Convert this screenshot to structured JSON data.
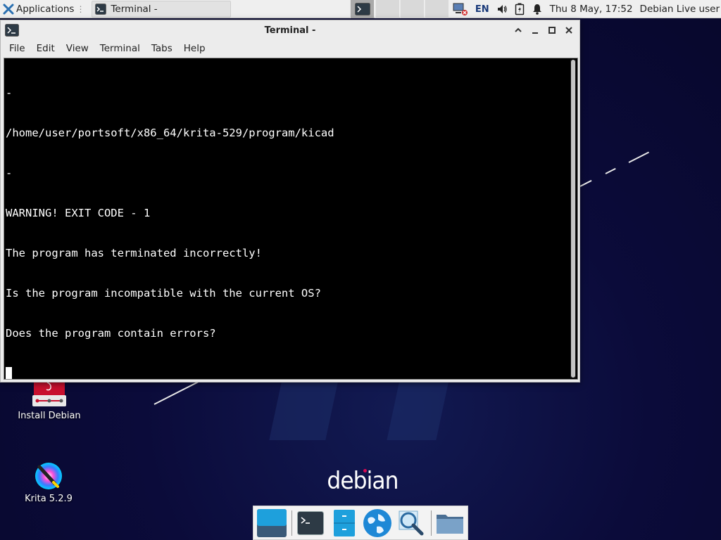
{
  "top_panel": {
    "applications_label": "Applications",
    "task_label": "Terminal -",
    "language": "EN",
    "clock": "Thu  8 May, 17:52",
    "user": "Debian Live user"
  },
  "window": {
    "title": "Terminal -",
    "menu": [
      "File",
      "Edit",
      "View",
      "Terminal",
      "Tabs",
      "Help"
    ],
    "terminal_lines": [
      "-",
      "/home/user/portsoft/x86_64/krita-529/program/kicad",
      "-",
      "WARNING! EXIT CODE - 1",
      "The program has terminated incorrectly!",
      "Is the program incompatible with the current OS?",
      "Does the program contain errors?"
    ]
  },
  "desktop": {
    "icons": [
      {
        "label": "Install Debian",
        "icon": "debian-installer-icon"
      },
      {
        "label": "Krita 5.2.9",
        "icon": "krita-icon"
      }
    ],
    "logo_text": "debian"
  },
  "dock": {
    "items": [
      "show-desktop-icon",
      "terminal-icon",
      "file-manager-icon",
      "web-browser-icon",
      "app-finder-icon",
      "folder-icon"
    ]
  }
}
